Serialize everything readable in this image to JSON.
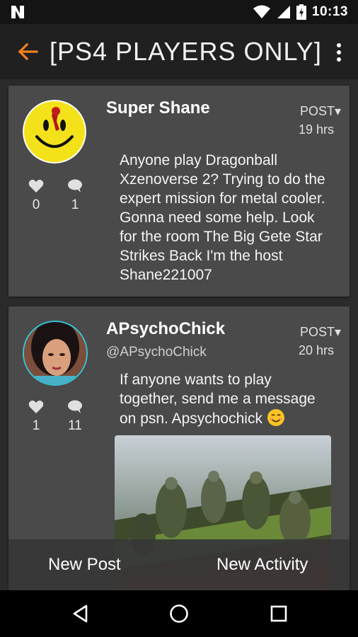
{
  "status_bar": {
    "time": "10:13",
    "icons": [
      "n-icon",
      "wifi-icon",
      "signal-icon",
      "battery-icon"
    ]
  },
  "app_bar": {
    "title": "[PS4 PLAYERS ONLY]",
    "back_icon": "arrow-back-icon",
    "menu_icon": "overflow-menu-icon",
    "accent_color": "#f0821e"
  },
  "posts": [
    {
      "author": "Super Shane",
      "handle": "",
      "post_label": "POST▾",
      "time": "19 hrs",
      "likes": "0",
      "comments": "1",
      "text": "Anyone play Dragonball Xzenoverse 2? Trying to do the expert mission for metal cooler. Gonna need some help. Look for the room The Big Gete Star Strikes Back I'm the host Shane221007"
    },
    {
      "author": "APsychoChick",
      "handle": "@APsychoChick",
      "post_label": "POST▾",
      "time": "20 hrs",
      "likes": "1",
      "comments": "11",
      "text": "If anyone wants to play together, send me a message on psn. Apsychochick"
    }
  ],
  "actions": {
    "new_post": "New Post",
    "new_activity": "New Activity"
  },
  "nav": [
    "back-triangle-icon",
    "home-circle-icon",
    "recents-square-icon"
  ]
}
